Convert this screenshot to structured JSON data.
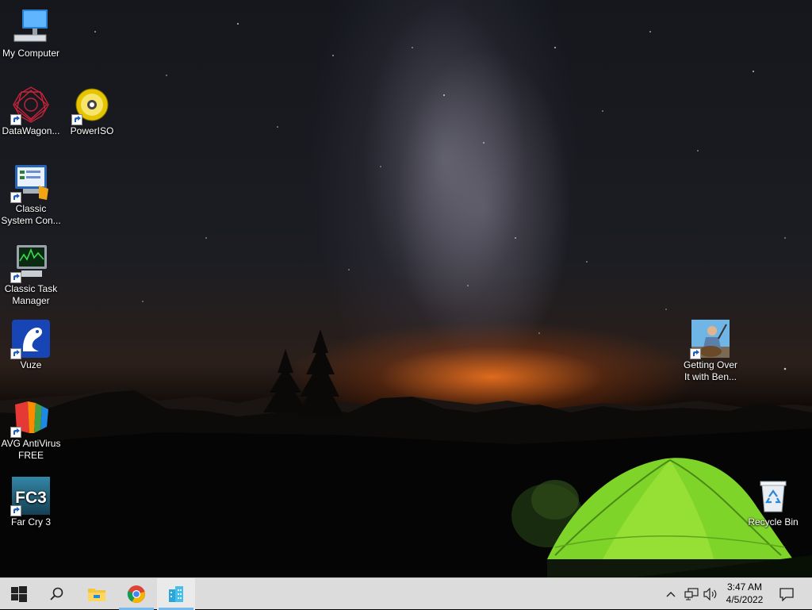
{
  "desktop": {
    "icons": [
      {
        "id": "my-computer",
        "label": "My Computer"
      },
      {
        "id": "datawagon",
        "label": "DataWagon..."
      },
      {
        "id": "poweriso",
        "label": "PowerISO"
      },
      {
        "id": "classic-system-control",
        "label": "Classic System Con..."
      },
      {
        "id": "classic-task-manager",
        "label": "Classic Task Manager"
      },
      {
        "id": "vuze",
        "label": "Vuze"
      },
      {
        "id": "avg-antivirus",
        "label": "AVG AntiVirus FREE"
      },
      {
        "id": "far-cry-3",
        "label": "Far Cry 3",
        "glyph": "FC3"
      },
      {
        "id": "getting-over-it",
        "label": "Getting Over It with Ben..."
      },
      {
        "id": "recycle-bin",
        "label": "Recycle Bin"
      }
    ]
  },
  "taskbar": {
    "buttons": [
      {
        "name": "start-button",
        "icon": "windows-logo-icon"
      },
      {
        "name": "search-button",
        "icon": "search-icon"
      },
      {
        "name": "file-explorer-button",
        "icon": "folder-icon"
      },
      {
        "name": "chrome-button",
        "icon": "chrome-icon",
        "active": true
      },
      {
        "name": "open-app-button",
        "icon": "buildings-icon",
        "active": true
      }
    ],
    "tray": {
      "icons": [
        "chevron-up-icon",
        "network-icon",
        "volume-icon",
        "notification-icon"
      ],
      "time": "3:47 AM",
      "date": "4/5/2022"
    }
  },
  "colors": {
    "taskbar_bg": "#dcdcdc",
    "active_indicator": "#76b9ed",
    "tent_green": "#7fd42a",
    "sunset_orange": "#ff7a1e"
  }
}
